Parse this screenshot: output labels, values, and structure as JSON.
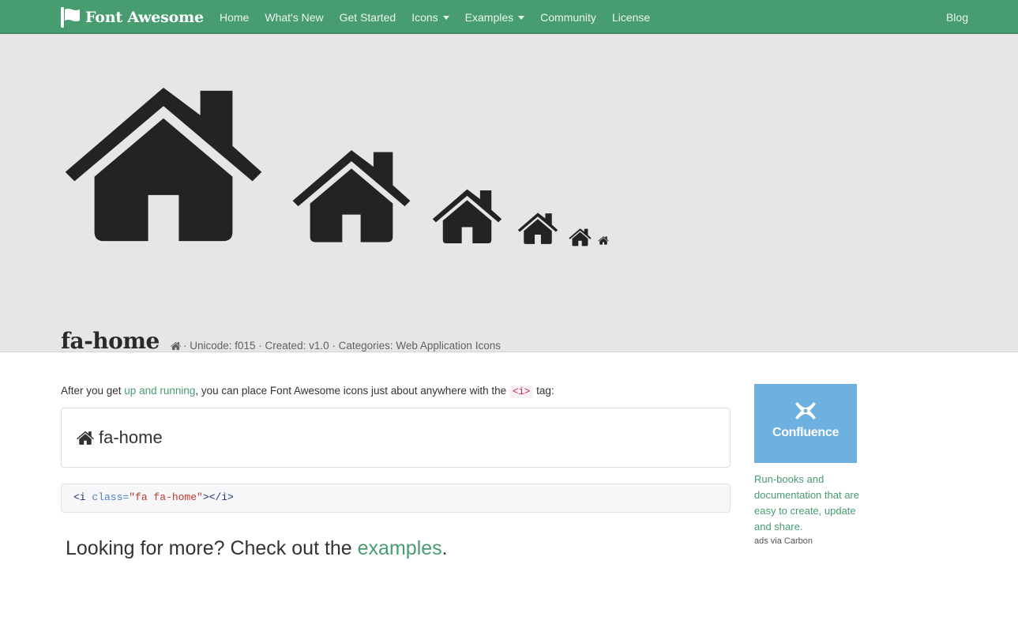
{
  "brand": {
    "name": "Font Awesome",
    "icon": "flag-icon"
  },
  "nav": {
    "items": [
      {
        "label": "Home"
      },
      {
        "label": "What's New"
      },
      {
        "label": "Get Started"
      },
      {
        "label": "Icons",
        "dropdown": true
      },
      {
        "label": "Examples",
        "dropdown": true
      },
      {
        "label": "Community"
      },
      {
        "label": "License"
      }
    ],
    "blog": "Blog"
  },
  "hero": {
    "title": "fa-home",
    "icon": "home-icon",
    "meta": "· Unicode: f015 · Created: v1.0 · Categories: Web Application Icons"
  },
  "intro": {
    "before": "After you get ",
    "link": "up and running",
    "middle": ", you can place Font Awesome icons just about anywhere with the ",
    "tag": "<i>",
    "after": " tag:"
  },
  "demo": {
    "label": "fa-home",
    "icon": "home-icon"
  },
  "code": {
    "open": "<i ",
    "attr": "class=",
    "value": "\"fa fa-home\"",
    "close": "></i>"
  },
  "more": {
    "before": "Looking for more? Check out the ",
    "link": "examples",
    "after": "."
  },
  "ad": {
    "brand": "Confluence",
    "text": "Run-books and documentation that are easy to create, update and share.",
    "via": "ads via Carbon"
  },
  "colors": {
    "navbar": "#479c70",
    "accent": "#479c70",
    "hero_bg": "#e6e6e6",
    "ad_bg": "#6eb0df"
  }
}
